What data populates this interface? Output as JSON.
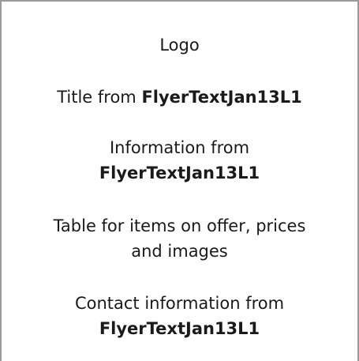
{
  "content": {
    "logo": "Logo",
    "title": {
      "prefix": "Title from ",
      "source": "FlyerTextJan13L1"
    },
    "information": {
      "line1": "Information from",
      "source": "FlyerTextJan13L1"
    },
    "table": {
      "line1": "Table for items on offer, prices",
      "line2": "and images"
    },
    "contact": {
      "line1": "Contact information from",
      "source": "FlyerTextJan13L1"
    }
  },
  "colors": {
    "border": "#9a9a9a",
    "text": "#1a1a1a",
    "background": "#ffffff"
  }
}
